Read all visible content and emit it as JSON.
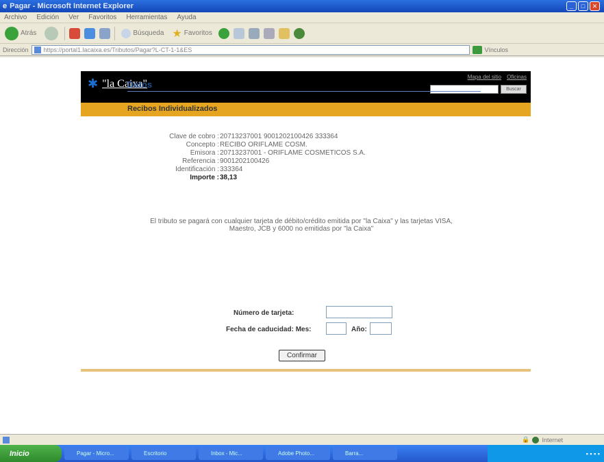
{
  "window": {
    "title": "Pagar - Microsoft Internet Explorer"
  },
  "menu": [
    "Archivo",
    "Edición",
    "Ver",
    "Favoritos",
    "Herramientas",
    "Ayuda"
  ],
  "toolbar": {
    "back": "Atrás",
    "search": "Búsqueda",
    "favorites": "Favoritos"
  },
  "address": {
    "label": "Dirección",
    "url": "https://portal1.lacaixa.es/Tributos/Pagar?L-CT-1-1&ES"
  },
  "links_label": "Vínculos",
  "site": {
    "logo": "\"la Caixa\"",
    "header_links": [
      "Mapa del sitio",
      "Oficinas"
    ],
    "search_button": "Buscar"
  },
  "section_title": "Datos",
  "subtitle": "Recibos Individualizados",
  "details": [
    {
      "label": "Clave de cobro :",
      "value": "20713237001 9001202100426 333364"
    },
    {
      "label": "Concepto :",
      "value": "RECIBO ORIFLAME COSM."
    },
    {
      "label": "Emisora :",
      "value": "20713237001 - ORIFLAME COSMETICOS S.A."
    },
    {
      "label": "Referencia :",
      "value": "9001202100426"
    },
    {
      "label": "Identificación :",
      "value": "333364"
    },
    {
      "label": "Importe :",
      "value": "38,13"
    }
  ],
  "notice": "El tributo se pagará con cualquier tarjeta de débito/crédito emitida por \"la Caixa\" y las tarjetas VISA, Maestro, JCB y 6000 no emitidas por \"la Caixa\"",
  "form": {
    "card_label": "Número de tarjeta:",
    "expiry_label": "Fecha de caducidad: Mes:",
    "year_label": "Año:",
    "confirm_button": "Confirmar"
  },
  "status": {
    "zone": "Internet"
  },
  "taskbar": {
    "start": "Inicio",
    "tasks": [
      "Pagar - Micro...",
      "Escritorio",
      "Inbox - Mic...",
      "Adobe Photo...",
      "Barra..."
    ]
  }
}
